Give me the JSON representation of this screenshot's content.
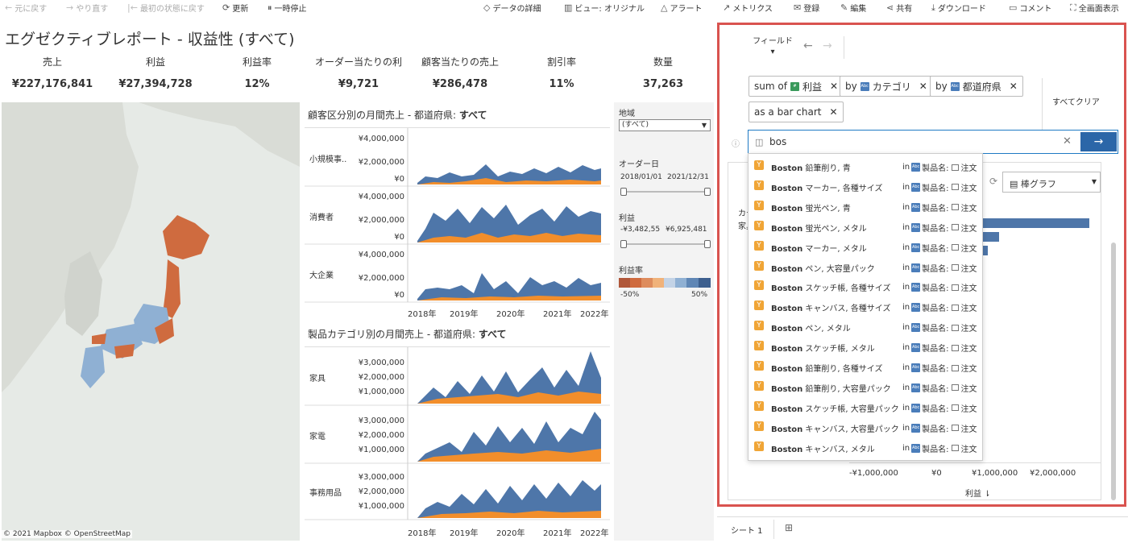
{
  "toolbar": {
    "undo": "元に戻す",
    "redo": "やり直す",
    "revert": "最初の状態に戻す",
    "refresh": "更新",
    "pause": "一時停止",
    "data_details": "データの詳細",
    "view": "ビュー: オリジナル",
    "alert": "アラート",
    "metrics": "メトリクス",
    "subscribe": "登録",
    "edit": "編集",
    "share": "共有",
    "download": "ダウンロード",
    "comment": "コメント",
    "fullscreen": "全画面表示"
  },
  "dashboard": {
    "title": "エグゼクティブレポート - 収益性 (すべて)",
    "kpis": [
      {
        "label": "売上",
        "value": "¥227,176,841"
      },
      {
        "label": "利益",
        "value": "¥27,394,728"
      },
      {
        "label": "利益率",
        "value": "12%"
      },
      {
        "label": "オーダー当たりの利",
        "value": "¥9,721"
      },
      {
        "label": "顧客当たりの売上",
        "value": "¥286,478"
      },
      {
        "label": "割引率",
        "value": "11%"
      },
      {
        "label": "数量",
        "value": "37,263"
      }
    ],
    "map_credit": "© 2021 Mapbox © OpenStreetMap",
    "segment_chart": {
      "title_prefix": "顧客区分別の月間売上 - 都道府県: ",
      "title_bold": "すべて",
      "rows": [
        "小規模事..",
        "消費者",
        "大企業"
      ],
      "yticks": [
        "¥4,000,000",
        "¥2,000,000",
        "¥0"
      ],
      "xticks": [
        "2018年",
        "2019年",
        "2020年",
        "2021年",
        "2022年"
      ]
    },
    "category_chart": {
      "title_prefix": "製品カテゴリ別の月間売上 - 都道府県: ",
      "title_bold": "すべて",
      "rows": [
        "家具",
        "家電",
        "事務用品"
      ],
      "yticks": [
        "¥3,000,000",
        "¥2,000,000",
        "¥1,000,000"
      ],
      "xticks": [
        "2018年",
        "2019年",
        "2020年",
        "2021年",
        "2022年"
      ]
    },
    "colors": {
      "area_blue": "#4e76a9",
      "area_orange": "#f28e2b",
      "map_orange": "#cf6b3f",
      "map_blue": "#8fb0d3"
    }
  },
  "filters": {
    "region_label": "地域",
    "region_value": "(すべて)",
    "order_date_label": "オーダー日",
    "order_date_start": "2018/01/01",
    "order_date_end": "2021/12/31",
    "profit_label": "利益",
    "profit_min": "-¥3,482,55",
    "profit_max": "¥6,925,481",
    "margin_label": "利益率",
    "margin_min": "-50%",
    "margin_max": "50%"
  },
  "ask_data": {
    "fields_label": "フィールド",
    "pills": [
      {
        "prefix": "sum of",
        "badge": "#",
        "field": "利益"
      },
      {
        "prefix": "by",
        "badge": "Abc",
        "field": "カテゴリ"
      },
      {
        "prefix": "by",
        "badge": "Abc",
        "field": "都道府県"
      },
      {
        "prefix": "",
        "badge": "",
        "field": "as a bar chart"
      }
    ],
    "clear_all": "すべてクリア",
    "search_value": "bos",
    "viz_type": "棒グラフ",
    "x_axis_label": "利益",
    "x_ticks": [
      "-¥1,000,000",
      "¥0",
      "¥1,000,000",
      "¥2,000,000"
    ],
    "row_header": "カテ",
    "row_first": "家具",
    "suggestions": [
      {
        "brand": "Boston",
        "name": "鉛筆削り, 青"
      },
      {
        "brand": "Boston",
        "name": "マーカー, 各種サイズ"
      },
      {
        "brand": "Boston",
        "name": "蛍光ペン, 青"
      },
      {
        "brand": "Boston",
        "name": "蛍光ペン, メタル"
      },
      {
        "brand": "Boston",
        "name": "マーカー, メタル"
      },
      {
        "brand": "Boston",
        "name": "ペン, 大容量パック"
      },
      {
        "brand": "Boston",
        "name": "スケッチ帳, 各種サイズ"
      },
      {
        "brand": "Boston",
        "name": "キャンバス, 各種サイズ"
      },
      {
        "brand": "Boston",
        "name": "ペン, メタル"
      },
      {
        "brand": "Boston",
        "name": "スケッチ帳, メタル"
      },
      {
        "brand": "Boston",
        "name": "鉛筆削り, 各種サイズ"
      },
      {
        "brand": "Boston",
        "name": "鉛筆削り, 大容量パック"
      },
      {
        "brand": "Boston",
        "name": "スケッチ帳, 大容量パック"
      },
      {
        "brand": "Boston",
        "name": "キャンバス, 大容量パック"
      },
      {
        "brand": "Boston",
        "name": "キャンバス, メタル"
      }
    ],
    "suggestion_in": "in",
    "suggestion_field": "製品名:",
    "suggestion_table": "注文",
    "sheet_tab": "シート 1"
  }
}
